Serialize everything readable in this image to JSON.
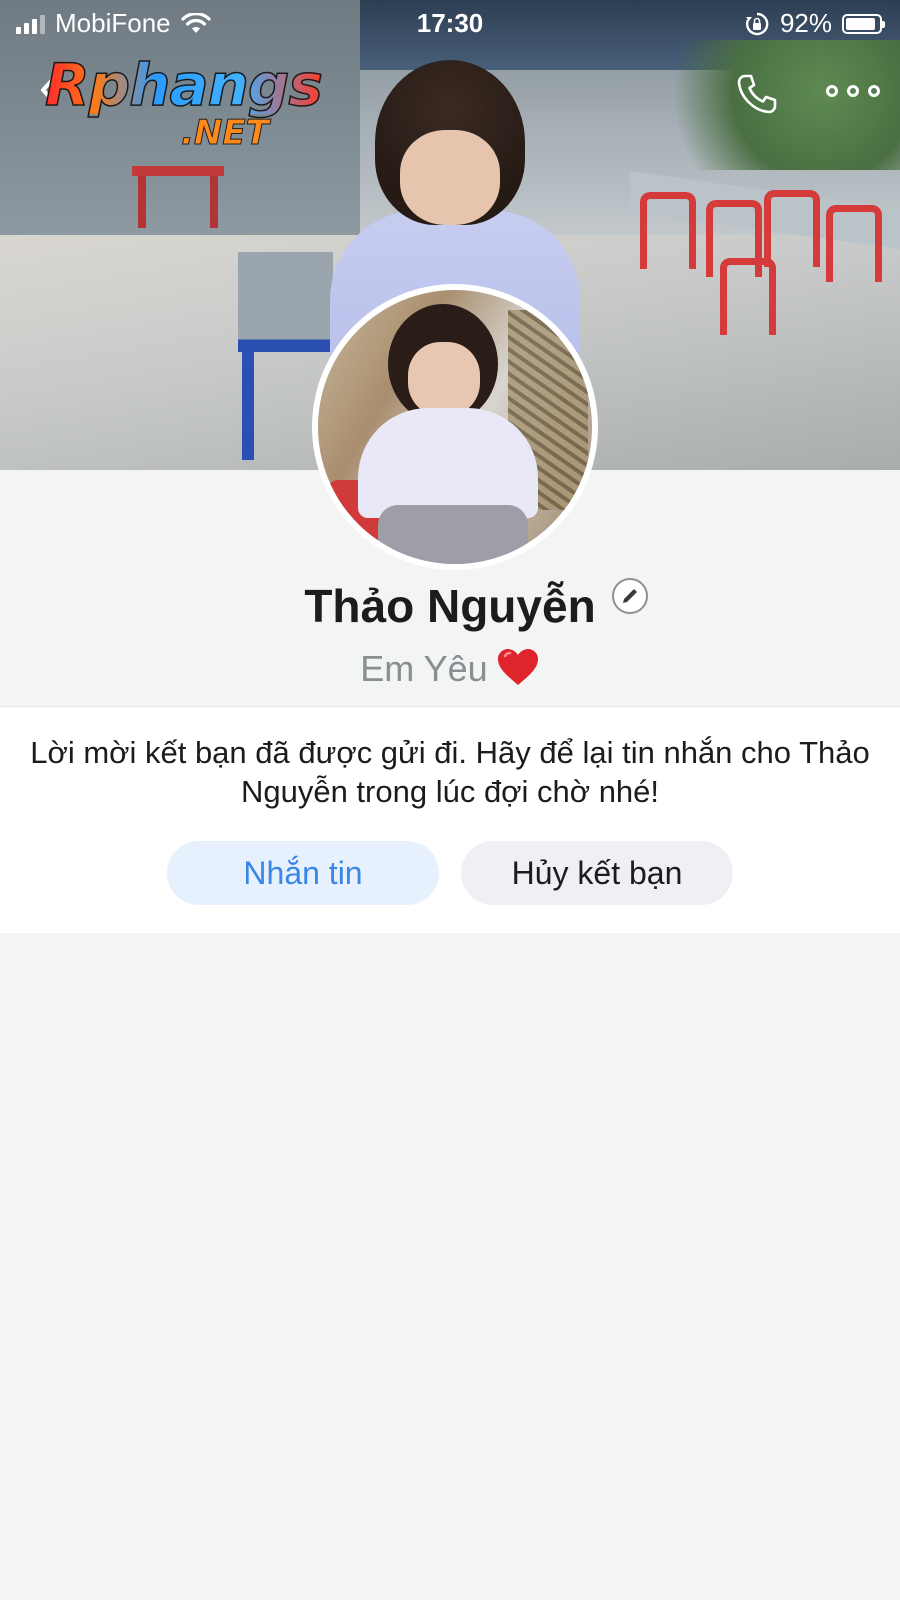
{
  "status_bar": {
    "carrier": "MobiFone",
    "time": "17:30",
    "battery_percent": "92%",
    "battery_level": 0.92,
    "icons": [
      "signal-icon",
      "wifi-icon",
      "rotation-lock-icon",
      "battery-icon"
    ]
  },
  "header": {
    "logo_main": "Rphangs",
    "logo_suffix": ".NET",
    "back_icon": "chevron-left-icon",
    "call_icon": "phone-icon",
    "more_icon": "more-dots-icon"
  },
  "profile": {
    "name": "Thảo Nguyễn",
    "status": "Em Yêu",
    "status_emoji_icon": "heart-icon",
    "edit_icon": "pencil-icon"
  },
  "friend_request": {
    "message": "Lời mời kết bạn đã được gửi đi. Hãy để lại tin nhắn cho Thảo Nguyễn trong lúc đợi chờ nhé!",
    "message_button": "Nhắn tin",
    "cancel_button": "Hủy kết bạn"
  },
  "colors": {
    "accent_blue": "#3a86e8",
    "message_button_bg": "#e6f1fd",
    "cancel_button_bg": "#eef0f3",
    "page_bg": "#f3f5f5",
    "heart_red": "#e0242b"
  }
}
